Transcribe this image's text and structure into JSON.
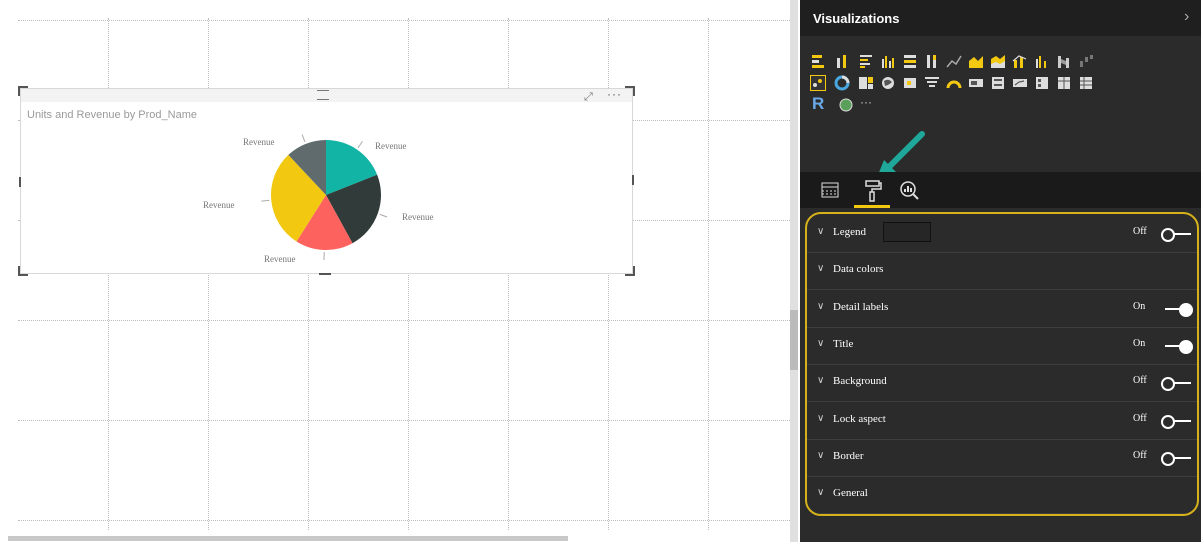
{
  "visual": {
    "title": "Units and Revenue by Prod_Name",
    "chart_data": {
      "type": "pie",
      "slices": [
        {
          "label": "Revenue",
          "value": 19,
          "color": "#11b4a5"
        },
        {
          "label": "Revenue",
          "value": 23,
          "color": "#313b3a"
        },
        {
          "label": "Revenue",
          "value": 17,
          "color": "#fd625e"
        },
        {
          "label": "Revenue",
          "value": 29,
          "color": "#f2c811"
        },
        {
          "label": "Revenue",
          "value": 12,
          "color": "#5f6b6d"
        }
      ]
    }
  },
  "panel": {
    "title": "Visualizations",
    "collapse_glyph": "›",
    "more_glyph": "···",
    "r_glyph": "R",
    "accent": "#f2c811",
    "properties": [
      {
        "label": "Legend",
        "state": "Off",
        "toggle": "off"
      },
      {
        "label": "Data colors",
        "state": "",
        "toggle": "none"
      },
      {
        "label": "Detail labels",
        "state": "On",
        "toggle": "on"
      },
      {
        "label": "Title",
        "state": "On",
        "toggle": "on"
      },
      {
        "label": "Background",
        "state": "Off",
        "toggle": "off"
      },
      {
        "label": "Lock aspect",
        "state": "Off",
        "toggle": "off"
      },
      {
        "label": "Border",
        "state": "Off",
        "toggle": "off"
      },
      {
        "label": "General",
        "state": "",
        "toggle": "none"
      }
    ]
  }
}
